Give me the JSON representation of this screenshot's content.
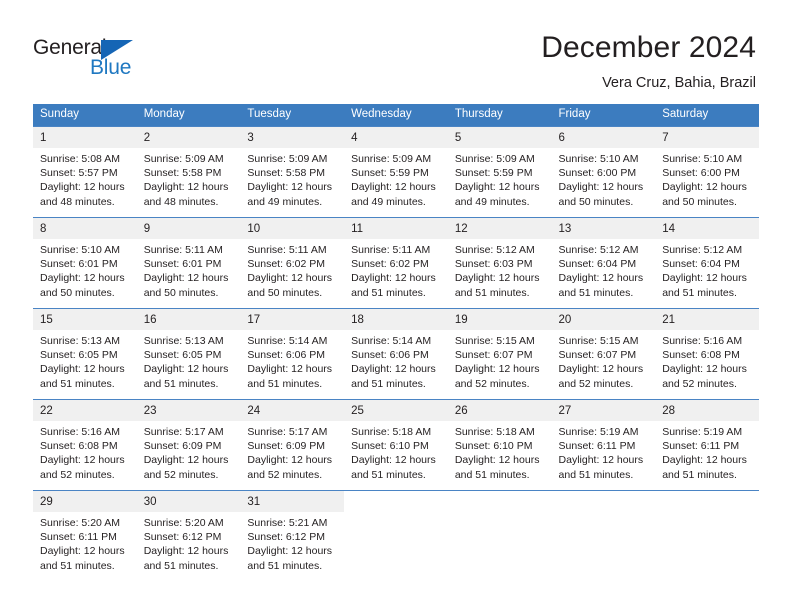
{
  "brand": {
    "name_part1": "General",
    "name_part2": "Blue",
    "triangle_color": "#1565b5",
    "blue_text_color": "#1f78c1"
  },
  "header": {
    "title": "December 2024",
    "subtitle": "Vera Cruz, Bahia, Brazil"
  },
  "theme": {
    "header_row_bg": "#3c7cbf",
    "daynum_bg": "#f0f0f0",
    "grid_line": "#4a84c4",
    "text": "#231f20"
  },
  "weekdays": [
    "Sunday",
    "Monday",
    "Tuesday",
    "Wednesday",
    "Thursday",
    "Friday",
    "Saturday"
  ],
  "weeks": [
    [
      {
        "day": "1",
        "sunrise": "Sunrise: 5:08 AM",
        "sunset": "Sunset: 5:57 PM",
        "daylight1": "Daylight: 12 hours",
        "daylight2": "and 48 minutes."
      },
      {
        "day": "2",
        "sunrise": "Sunrise: 5:09 AM",
        "sunset": "Sunset: 5:58 PM",
        "daylight1": "Daylight: 12 hours",
        "daylight2": "and 48 minutes."
      },
      {
        "day": "3",
        "sunrise": "Sunrise: 5:09 AM",
        "sunset": "Sunset: 5:58 PM",
        "daylight1": "Daylight: 12 hours",
        "daylight2": "and 49 minutes."
      },
      {
        "day": "4",
        "sunrise": "Sunrise: 5:09 AM",
        "sunset": "Sunset: 5:59 PM",
        "daylight1": "Daylight: 12 hours",
        "daylight2": "and 49 minutes."
      },
      {
        "day": "5",
        "sunrise": "Sunrise: 5:09 AM",
        "sunset": "Sunset: 5:59 PM",
        "daylight1": "Daylight: 12 hours",
        "daylight2": "and 49 minutes."
      },
      {
        "day": "6",
        "sunrise": "Sunrise: 5:10 AM",
        "sunset": "Sunset: 6:00 PM",
        "daylight1": "Daylight: 12 hours",
        "daylight2": "and 50 minutes."
      },
      {
        "day": "7",
        "sunrise": "Sunrise: 5:10 AM",
        "sunset": "Sunset: 6:00 PM",
        "daylight1": "Daylight: 12 hours",
        "daylight2": "and 50 minutes."
      }
    ],
    [
      {
        "day": "8",
        "sunrise": "Sunrise: 5:10 AM",
        "sunset": "Sunset: 6:01 PM",
        "daylight1": "Daylight: 12 hours",
        "daylight2": "and 50 minutes."
      },
      {
        "day": "9",
        "sunrise": "Sunrise: 5:11 AM",
        "sunset": "Sunset: 6:01 PM",
        "daylight1": "Daylight: 12 hours",
        "daylight2": "and 50 minutes."
      },
      {
        "day": "10",
        "sunrise": "Sunrise: 5:11 AM",
        "sunset": "Sunset: 6:02 PM",
        "daylight1": "Daylight: 12 hours",
        "daylight2": "and 50 minutes."
      },
      {
        "day": "11",
        "sunrise": "Sunrise: 5:11 AM",
        "sunset": "Sunset: 6:02 PM",
        "daylight1": "Daylight: 12 hours",
        "daylight2": "and 51 minutes."
      },
      {
        "day": "12",
        "sunrise": "Sunrise: 5:12 AM",
        "sunset": "Sunset: 6:03 PM",
        "daylight1": "Daylight: 12 hours",
        "daylight2": "and 51 minutes."
      },
      {
        "day": "13",
        "sunrise": "Sunrise: 5:12 AM",
        "sunset": "Sunset: 6:04 PM",
        "daylight1": "Daylight: 12 hours",
        "daylight2": "and 51 minutes."
      },
      {
        "day": "14",
        "sunrise": "Sunrise: 5:12 AM",
        "sunset": "Sunset: 6:04 PM",
        "daylight1": "Daylight: 12 hours",
        "daylight2": "and 51 minutes."
      }
    ],
    [
      {
        "day": "15",
        "sunrise": "Sunrise: 5:13 AM",
        "sunset": "Sunset: 6:05 PM",
        "daylight1": "Daylight: 12 hours",
        "daylight2": "and 51 minutes."
      },
      {
        "day": "16",
        "sunrise": "Sunrise: 5:13 AM",
        "sunset": "Sunset: 6:05 PM",
        "daylight1": "Daylight: 12 hours",
        "daylight2": "and 51 minutes."
      },
      {
        "day": "17",
        "sunrise": "Sunrise: 5:14 AM",
        "sunset": "Sunset: 6:06 PM",
        "daylight1": "Daylight: 12 hours",
        "daylight2": "and 51 minutes."
      },
      {
        "day": "18",
        "sunrise": "Sunrise: 5:14 AM",
        "sunset": "Sunset: 6:06 PM",
        "daylight1": "Daylight: 12 hours",
        "daylight2": "and 51 minutes."
      },
      {
        "day": "19",
        "sunrise": "Sunrise: 5:15 AM",
        "sunset": "Sunset: 6:07 PM",
        "daylight1": "Daylight: 12 hours",
        "daylight2": "and 52 minutes."
      },
      {
        "day": "20",
        "sunrise": "Sunrise: 5:15 AM",
        "sunset": "Sunset: 6:07 PM",
        "daylight1": "Daylight: 12 hours",
        "daylight2": "and 52 minutes."
      },
      {
        "day": "21",
        "sunrise": "Sunrise: 5:16 AM",
        "sunset": "Sunset: 6:08 PM",
        "daylight1": "Daylight: 12 hours",
        "daylight2": "and 52 minutes."
      }
    ],
    [
      {
        "day": "22",
        "sunrise": "Sunrise: 5:16 AM",
        "sunset": "Sunset: 6:08 PM",
        "daylight1": "Daylight: 12 hours",
        "daylight2": "and 52 minutes."
      },
      {
        "day": "23",
        "sunrise": "Sunrise: 5:17 AM",
        "sunset": "Sunset: 6:09 PM",
        "daylight1": "Daylight: 12 hours",
        "daylight2": "and 52 minutes."
      },
      {
        "day": "24",
        "sunrise": "Sunrise: 5:17 AM",
        "sunset": "Sunset: 6:09 PM",
        "daylight1": "Daylight: 12 hours",
        "daylight2": "and 52 minutes."
      },
      {
        "day": "25",
        "sunrise": "Sunrise: 5:18 AM",
        "sunset": "Sunset: 6:10 PM",
        "daylight1": "Daylight: 12 hours",
        "daylight2": "and 51 minutes."
      },
      {
        "day": "26",
        "sunrise": "Sunrise: 5:18 AM",
        "sunset": "Sunset: 6:10 PM",
        "daylight1": "Daylight: 12 hours",
        "daylight2": "and 51 minutes."
      },
      {
        "day": "27",
        "sunrise": "Sunrise: 5:19 AM",
        "sunset": "Sunset: 6:11 PM",
        "daylight1": "Daylight: 12 hours",
        "daylight2": "and 51 minutes."
      },
      {
        "day": "28",
        "sunrise": "Sunrise: 5:19 AM",
        "sunset": "Sunset: 6:11 PM",
        "daylight1": "Daylight: 12 hours",
        "daylight2": "and 51 minutes."
      }
    ],
    [
      {
        "day": "29",
        "sunrise": "Sunrise: 5:20 AM",
        "sunset": "Sunset: 6:11 PM",
        "daylight1": "Daylight: 12 hours",
        "daylight2": "and 51 minutes."
      },
      {
        "day": "30",
        "sunrise": "Sunrise: 5:20 AM",
        "sunset": "Sunset: 6:12 PM",
        "daylight1": "Daylight: 12 hours",
        "daylight2": "and 51 minutes."
      },
      {
        "day": "31",
        "sunrise": "Sunrise: 5:21 AM",
        "sunset": "Sunset: 6:12 PM",
        "daylight1": "Daylight: 12 hours",
        "daylight2": "and 51 minutes."
      },
      {
        "day": "",
        "sunrise": "",
        "sunset": "",
        "daylight1": "",
        "daylight2": ""
      },
      {
        "day": "",
        "sunrise": "",
        "sunset": "",
        "daylight1": "",
        "daylight2": ""
      },
      {
        "day": "",
        "sunrise": "",
        "sunset": "",
        "daylight1": "",
        "daylight2": ""
      },
      {
        "day": "",
        "sunrise": "",
        "sunset": "",
        "daylight1": "",
        "daylight2": ""
      }
    ]
  ]
}
